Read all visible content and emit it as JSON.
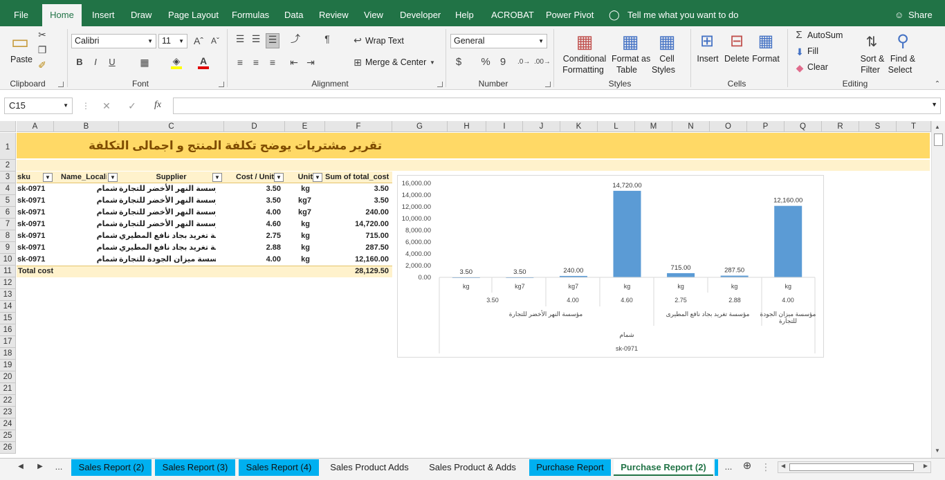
{
  "ribbon_tabs": [
    "File",
    "Home",
    "Insert",
    "Draw",
    "Page Layout",
    "Formulas",
    "Data",
    "Review",
    "View",
    "Developer",
    "Help",
    "ACROBAT",
    "Power Pivot"
  ],
  "tell_me": "Tell me what you want to do",
  "share": "Share",
  "clipboard": {
    "paste": "Paste",
    "label": "Clipboard"
  },
  "font": {
    "name": "Calibri",
    "size": "11",
    "label": "Font",
    "bold": "B",
    "italic": "I",
    "underline": "U"
  },
  "alignment": {
    "wrap": "Wrap Text",
    "merge": "Merge & Center",
    "label": "Alignment"
  },
  "number": {
    "format": "General",
    "currency": "$",
    "percent": "%",
    "comma": "9",
    "label": "Number"
  },
  "styles": {
    "conditional": "Conditional",
    "conditional2": "Formatting",
    "format_table": "Format as",
    "format_table2": "Table",
    "cell_styles": "Cell",
    "cell_styles2": "Styles",
    "label": "Styles"
  },
  "cells": {
    "insert": "Insert",
    "delete": "Delete",
    "format": "Format",
    "label": "Cells"
  },
  "editing": {
    "autosum": "AutoSum",
    "fill": "Fill",
    "clear": "Clear",
    "sort": "Sort &",
    "sort2": "Filter",
    "find": "Find &",
    "find2": "Select",
    "label": "Editing"
  },
  "name_box": "C15",
  "fx": "fx",
  "columns": [
    "A",
    "B",
    "C",
    "D",
    "E",
    "F",
    "G",
    "H",
    "I",
    "J",
    "K",
    "L",
    "M",
    "N",
    "O",
    "P",
    "Q",
    "R",
    "S",
    "T"
  ],
  "rows": [
    "1",
    "2",
    "3",
    "4",
    "5",
    "6",
    "7",
    "8",
    "9",
    "10",
    "11",
    "12",
    "13",
    "14",
    "15",
    "16",
    "17",
    "18",
    "19",
    "20",
    "21",
    "22",
    "23",
    "24",
    "25",
    "26"
  ],
  "sheet": {
    "title": "تقرير مشتريات يوضح  تكلفة المنتج و اجمالى التكلفة",
    "headers": [
      "sku",
      "Name_Locali:",
      "Supplier",
      "Cost / Unit",
      "Unit",
      "Sum of total_cost"
    ],
    "rows": [
      [
        "sk-0971",
        "شمام",
        "مؤسسة النهر الأخضر للتجارة",
        "3.50",
        "kg",
        "3.50"
      ],
      [
        "sk-0971",
        "شمام",
        "مؤسسة النهر الأخضر للتجارة",
        "3.50",
        "kg7",
        "3.50"
      ],
      [
        "sk-0971",
        "شمام",
        "مؤسسة النهر الأخضر للتجارة",
        "4.00",
        "kg7",
        "240.00"
      ],
      [
        "sk-0971",
        "شمام",
        "مؤسسة النهر الأخضر للتجارة",
        "4.60",
        "kg",
        "14,720.00"
      ],
      [
        "sk-0971",
        "شمام",
        "مؤسسة تغريد بجاد نافع المطيري",
        "2.75",
        "kg",
        "715.00"
      ],
      [
        "sk-0971",
        "شمام",
        "مؤسسة تغريد بجاد نافع المطيري",
        "2.88",
        "kg",
        "287.50"
      ],
      [
        "sk-0971",
        "شمام",
        "مؤسسة ميزان الجودة للتجارة",
        "4.00",
        "kg",
        "12,160.00"
      ]
    ],
    "total_label": "Total cost",
    "total_value": "28,129.50"
  },
  "chart_data": {
    "type": "bar",
    "values": [
      3.5,
      3.5,
      240,
      14720,
      715,
      287.5,
      12160
    ],
    "labels": [
      "3.50",
      "3.50",
      "240.00",
      "14,720.00",
      "715.00",
      "287.50",
      "12,160.00"
    ],
    "ylim": [
      0,
      16000
    ],
    "yticks": [
      "16,000.00",
      "14,000.00",
      "12,000.00",
      "10,000.00",
      "8,000.00",
      "6,000.00",
      "4,000.00",
      "2,000.00",
      "0.00"
    ],
    "level_unit": [
      "kg",
      "kg7",
      "kg7",
      "kg",
      "kg",
      "kg",
      "kg"
    ],
    "level_cost": [
      "3.50",
      "4.00",
      "4.60",
      "2.75",
      "2.88",
      "4.00"
    ],
    "level_supplier": [
      "مؤسسة النهر الأخضر للتجارة",
      "مؤسسة تغريد بجاد نافع المطيرى",
      "مؤسسة ميزان الجودة",
      "للتجارة"
    ],
    "level_name": "شمام",
    "level_sku": "sk-0971",
    "bar_color": "#5b9bd5"
  },
  "sheet_tabs": [
    "Sales Report (2)",
    "Sales Report (3)",
    "Sales Report (4)",
    "Sales Product Adds",
    "Sales Product & Adds",
    "Purchase Report",
    "Purchase Report (2)"
  ],
  "ellipsis": "...",
  "colors": {
    "excel_green": "#217346",
    "title_fill": "#ffd966",
    "header_fill": "#fff2cc",
    "tab_blue": "#00b0f0"
  }
}
